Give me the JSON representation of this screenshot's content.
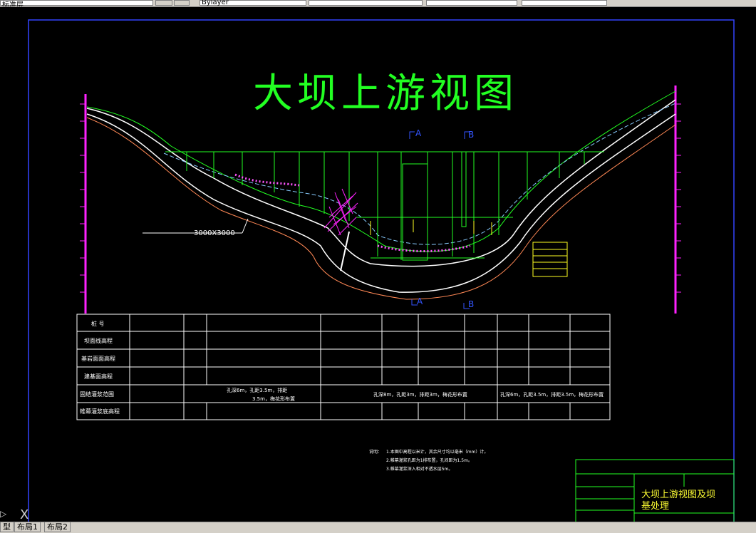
{
  "toolbar": {
    "left_field": "标准层",
    "mid_field": "Bylayer"
  },
  "drawing": {
    "title": "大坝上游视图",
    "section_markers": {
      "a_top": "A",
      "b_top": "B",
      "a_bottom": "A",
      "b_bottom": "B"
    },
    "culvert_label": "3000X3000",
    "table": {
      "row_headers": [
        "桩 号",
        "坝面线高程",
        "基岩面面高程",
        "建基面高程",
        "固结灌浆范围",
        "帷幕灌浆底高程"
      ],
      "grout_notes": [
        "孔深6m，孔距3.5m，排距",
        "3.5m，梅花形布置",
        "孔深8m，孔距3m，排距3m，梅花形布置",
        "孔深6m，孔距3.5m，排距3.5m，梅花形布置"
      ]
    },
    "notes": {
      "label": "说明：",
      "lines": [
        "1.本图中高程以米计，其余尺寸均以毫米（mm）计。",
        "2.帷幕灌浆孔距为1排布置，孔间距为1.5m。",
        "3.帷幕灌浆深入相对不透水层5m。"
      ]
    },
    "title_block": {
      "line1": "大坝上游视图及坝",
      "line2": "基处理"
    }
  },
  "ucs_label": "X",
  "layout_tabs": [
    "型",
    "布局1",
    "布局2"
  ]
}
